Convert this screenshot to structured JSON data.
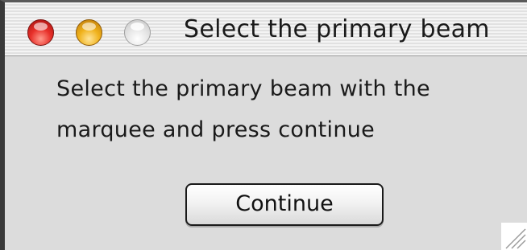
{
  "window": {
    "title": "Select the primary beam",
    "controls": {
      "close": "close-button",
      "minimize": "minimize-button",
      "zoom": "zoom-button"
    }
  },
  "dialog": {
    "message_line1": "Select the primary beam with the",
    "message_line2": "marquee and press continue",
    "continue_label": "Continue"
  },
  "colors": {
    "close": "#e8302a",
    "minimize": "#f0b21c",
    "zoom": "#e4e4e4",
    "background": "#dcdcdc"
  }
}
